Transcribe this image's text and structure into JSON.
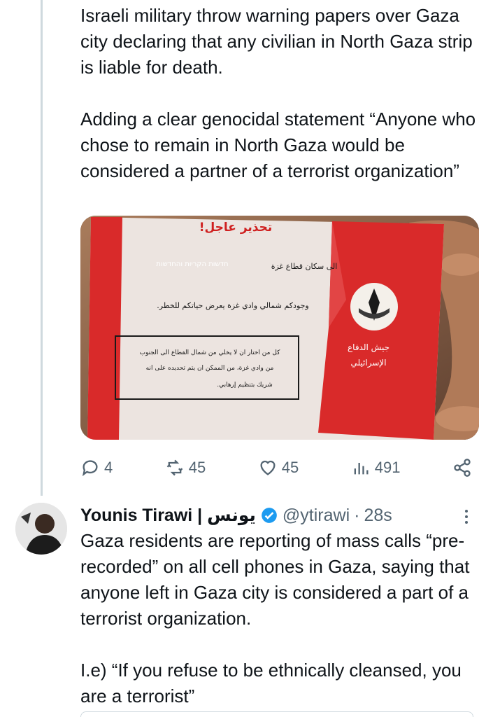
{
  "tweet1": {
    "text": "Israeli military throw warning papers over Gaza city declaring that any civilian in North Gaza strip is liable for death.\n\nAdding a clear genocidal statement “Anyone who chose to remain in North Gaza would be considered a partner of a terrorist organization”",
    "media": {
      "headline": "تحذير عاجل!",
      "watermark_hebrew": "חדשות הקריות והחדשות",
      "line1": "الى سكان قطاع غزة",
      "line2": "وجودكم شمالي وادي غزة يعرض حياتكم للخطر.",
      "box_line1": "كل من اختار ان لا يخلي من شمال القطاع الى الجنوب",
      "box_line2": "من وادي غزة، من الممكن ان يتم تحديده على انه",
      "box_line3": "شريك بتنظيم إرهابي.",
      "org_line1": "جيش الدفاع",
      "org_line2": "الإسرائيلي",
      "accent_color": "#d92a2a"
    },
    "actions": {
      "replies": "4",
      "retweets": "45",
      "likes": "45",
      "views": "491"
    }
  },
  "tweet2": {
    "name": "Younis Tirawi | يونس",
    "handle": "@ytirawi",
    "dot": "·",
    "time": "28s",
    "text": "Gaza residents are reporting of mass calls “pre-recorded” on all cell phones in Gaza, saying that anyone left in Gaza city is considered a part of a terrorist organization.\n\nI.e) “If you refuse to be ethnically cleansed, you are a terrorist”",
    "verified_color": "#1d9bf0"
  },
  "icons": [
    "reply-icon",
    "retweet-icon",
    "like-icon",
    "views-icon",
    "share-icon",
    "verified-icon",
    "more-icon"
  ]
}
